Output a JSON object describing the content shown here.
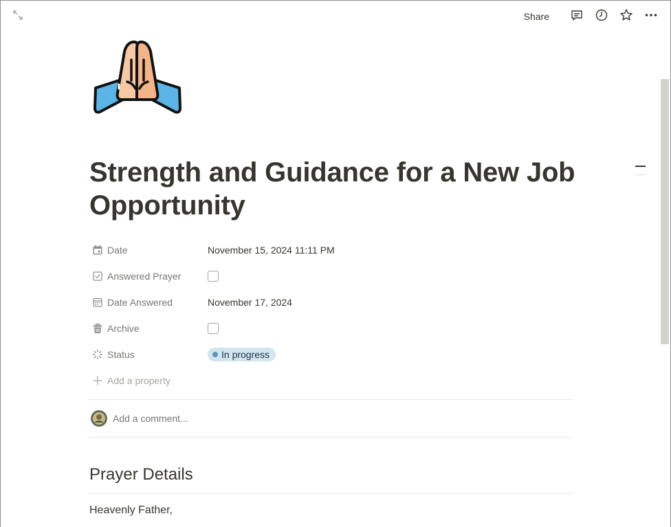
{
  "topbar": {
    "share_label": "Share",
    "icons": [
      "expand-icon",
      "comment-icon",
      "history-icon",
      "star-icon",
      "more-icon"
    ]
  },
  "page": {
    "icon": "folded-hands-emoji",
    "title": "Strength and Guidance for a New Job Opportunity"
  },
  "properties": [
    {
      "name": "Date",
      "icon": "calendar-icon",
      "value": "November 15, 2024 11:11 PM"
    },
    {
      "name": "Answered Prayer",
      "icon": "checkbox-icon",
      "checked": false
    },
    {
      "name": "Date Answered",
      "icon": "calendar-outline-icon",
      "value": "November 17, 2024"
    },
    {
      "name": "Archive",
      "icon": "trash-icon",
      "checked": false
    },
    {
      "name": "Status",
      "icon": "status-icon",
      "value": "In progress",
      "color": "#d3e5ef",
      "dot_color": "#5b97bd"
    }
  ],
  "add_property_label": "Add a property",
  "comment": {
    "placeholder": "Add a comment..."
  },
  "content": {
    "heading": "Prayer Details",
    "first_line": "Heavenly Father,"
  }
}
